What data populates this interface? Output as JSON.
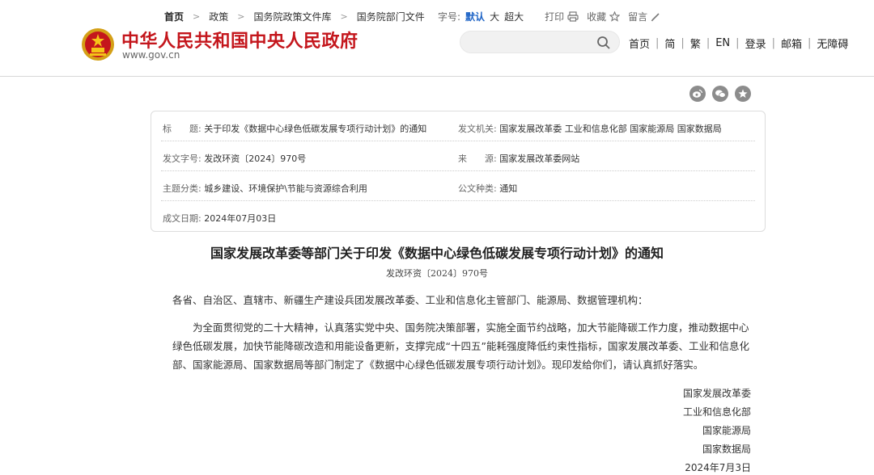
{
  "header": {
    "site_title": "中华人民共和国中央人民政府",
    "site_url": "www.gov.cn",
    "search_placeholder": "",
    "nav": [
      "首页",
      "简",
      "繁",
      "EN",
      "登录",
      "邮箱",
      "无障碍"
    ]
  },
  "breadcrumb": [
    "首页",
    "政策",
    "国务院政策文件库",
    "国务院部门文件"
  ],
  "tools": {
    "font_size_label": "字号:",
    "font_default": "默认",
    "font_large": "大",
    "font_xlarge": "超大",
    "print": "打印",
    "favorite": "收藏",
    "comment": "留言"
  },
  "info": {
    "title_key": "标　　题:",
    "title_value": "关于印发《数据中心绿色低碳发展专项行动计划》的通知",
    "issuer_key": "发文机关:",
    "issuer_value": "国家发展改革委 工业和信息化部 国家能源局 国家数据局",
    "doc_no_key": "发文字号:",
    "doc_no_value": "发改环资〔2024〕970号",
    "source_key": "来　　源:",
    "source_value": "国家发展改革委网站",
    "topic_key": "主题分类:",
    "topic_value": "城乡建设、环境保护\\节能与资源综合利用",
    "type_key": "公文种类:",
    "type_value": "通知",
    "date_key": "成文日期:",
    "date_value": "2024年07月03日"
  },
  "article": {
    "title": "国家发展改革委等部门关于印发《数据中心绿色低碳发展专项行动计划》的通知",
    "doc_no": "发改环资〔2024〕970号",
    "salutation": "各省、自治区、直辖市、新疆生产建设兵团发展改革委、工业和信息化主管部门、能源局、数据管理机构：",
    "body": "为全面贯彻党的二十大精神，认真落实党中央、国务院决策部署，实施全面节约战略，加大节能降碳工作力度，推动数据中心绿色低碳发展，加快节能降碳改造和用能设备更新，支撑完成“十四五”能耗强度降低约束性指标，国家发展改革委、工业和信息化部、国家能源局、国家数据局等部门制定了《数据中心绿色低碳发展专项行动计划》。现印发给你们，请认真抓好落实。",
    "signatures": [
      "国家发展改革委",
      "工业和信息化部",
      "国家能源局",
      "国家数据局"
    ],
    "sign_date": "2024年7月3日"
  },
  "colors": {
    "brand_red": "#c4161c",
    "active_blue": "#1d63c6"
  },
  "icons": [
    "national-emblem-icon",
    "search-icon",
    "print-icon",
    "star-icon",
    "pen-icon",
    "weibo-icon",
    "wechat-icon",
    "favorite-star-icon"
  ]
}
